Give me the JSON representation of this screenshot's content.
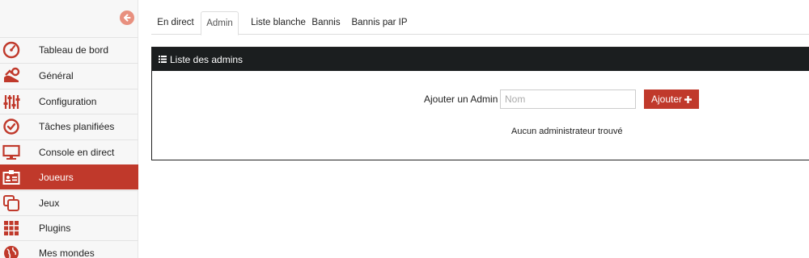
{
  "colors": {
    "accent": "#c0392b",
    "panel_header": "#1b1e1f",
    "collapse_button": "#e8907f"
  },
  "sidebar": {
    "collapse_icon": "arrow-left-circle-icon",
    "items": [
      {
        "label": "Tableau de bord",
        "icon": "speedometer-icon",
        "active": false
      },
      {
        "label": "Général",
        "icon": "cogs-icon",
        "active": false
      },
      {
        "label": "Configuration",
        "icon": "sliders-icon",
        "active": false
      },
      {
        "label": "Tâches planifiées",
        "icon": "clock-icon",
        "active": false
      },
      {
        "label": "Console en direct",
        "icon": "monitor-icon",
        "active": false
      },
      {
        "label": "Joueurs",
        "icon": "id-card-icon",
        "active": true
      },
      {
        "label": "Jeux",
        "icon": "copy-icon",
        "active": false
      },
      {
        "label": "Plugins",
        "icon": "grid-icon",
        "active": false
      },
      {
        "label": "Mes mondes",
        "icon": "globe-icon",
        "active": false
      }
    ]
  },
  "tabs": [
    {
      "label": "En direct",
      "active": false
    },
    {
      "label": "Admin",
      "active": true
    },
    {
      "label": "Liste blanche",
      "active": false
    },
    {
      "label": "Bannis",
      "active": false
    },
    {
      "label": "Bannis par IP",
      "active": false
    }
  ],
  "panel": {
    "title": "Liste des admins",
    "title_icon": "list-icon",
    "form_label": "Ajouter un Admin",
    "input_value": "",
    "input_placeholder": "Nom",
    "add_button_label": "Ajouter",
    "add_button_icon": "plus-icon",
    "empty_message": "Aucun administrateur trouvé"
  }
}
